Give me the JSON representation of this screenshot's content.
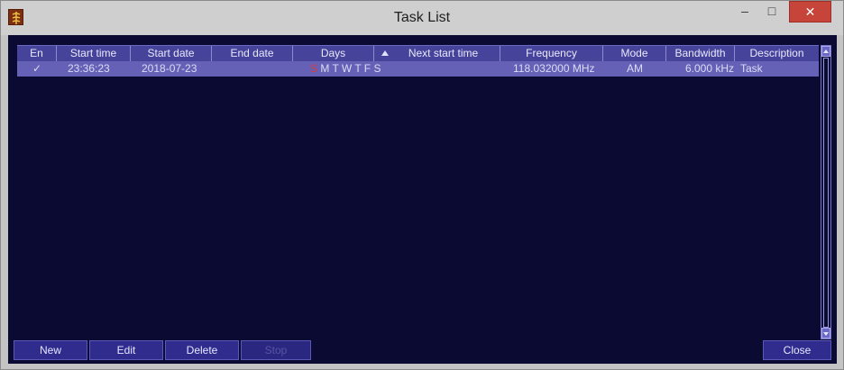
{
  "window": {
    "title": "Task List",
    "controls": {
      "minimize": "–",
      "maximize": "□",
      "close": "✕"
    }
  },
  "table": {
    "columns": {
      "en": "En",
      "start_time": "Start time",
      "start_date": "Start date",
      "end_date": "End date",
      "days": "Days",
      "next_start_time": "Next start time",
      "frequency": "Frequency",
      "mode": "Mode",
      "bandwidth": "Bandwidth",
      "description": "Description"
    },
    "rows": [
      {
        "enabled": "✓",
        "start_time": "23:36:23",
        "start_date": "2018-07-23",
        "end_date": "",
        "days": {
          "first": "S",
          "rest": "M T W T F S"
        },
        "next_start_time": "",
        "frequency": "118.032000 MHz",
        "mode": "AM",
        "bandwidth": "6.000 kHz",
        "description": "Task"
      }
    ]
  },
  "buttons": {
    "new": "New",
    "edit": "Edit",
    "delete": "Delete",
    "stop": "Stop",
    "close": "Close"
  },
  "colors": {
    "background": "#0b0a33",
    "header": "#46449a",
    "selected_row": "#6461b6",
    "button": "#2f2c8e",
    "close_button": "#c7443a"
  }
}
